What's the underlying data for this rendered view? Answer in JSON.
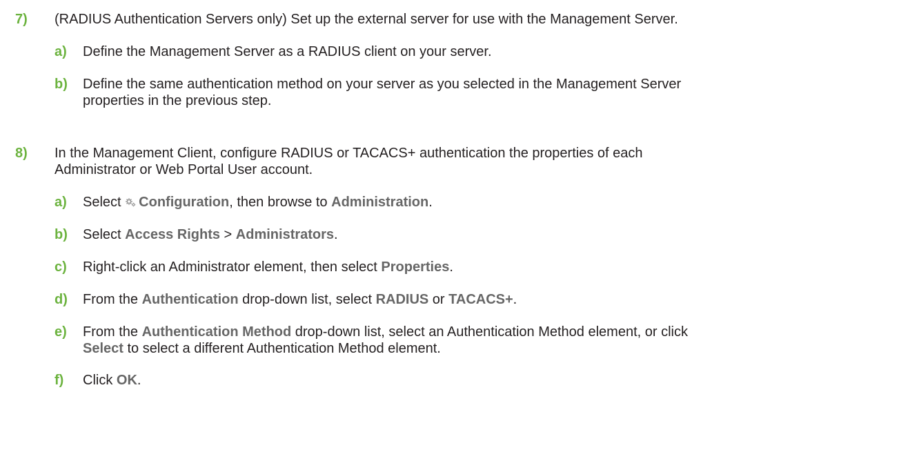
{
  "step7": {
    "number": "7)",
    "text": "(RADIUS Authentication Servers only) Set up the external server for use with the Management Server.",
    "substeps": [
      {
        "letter": "a)",
        "text": "Define the Management Server as a RADIUS client on your server."
      },
      {
        "letter": "b)",
        "line1": "Define the same authentication method on your server as you selected in the Management Server",
        "line2": "properties in the previous step."
      }
    ]
  },
  "step8": {
    "number": "8)",
    "line1": "In the Management Client, configure RADIUS or TACACS+ authentication the properties of each",
    "line2": "Administrator or Web Portal User account.",
    "substeps": {
      "a": {
        "letter": "a)",
        "pre": "Select ",
        "ui1": "Configuration",
        "mid": ", then browse to ",
        "ui2": "Administration",
        "post": ".",
        "icon": "configuration-gear-icon"
      },
      "b": {
        "letter": "b)",
        "pre": "Select ",
        "ui1": "Access Rights",
        "mid": " > ",
        "ui2": "Administrators",
        "post": "."
      },
      "c": {
        "letter": "c)",
        "pre": "Right-click an Administrator element, then select ",
        "ui1": "Properties",
        "post": "."
      },
      "d": {
        "letter": "d)",
        "pre": "From the ",
        "ui1": "Authentication",
        "mid": " drop-down list, select ",
        "ui2": "RADIUS",
        "mid2": " or ",
        "ui3": "TACACS+",
        "post": "."
      },
      "e": {
        "letter": "e)",
        "pre": "From the ",
        "ui1": "Authentication Method",
        "mid": " drop-down list, select an Authentication Method element, or click",
        "ui2": "Select",
        "post": " to select a different Authentication Method element."
      },
      "f": {
        "letter": "f)",
        "pre": "Click ",
        "ui1": "OK",
        "post": "."
      }
    }
  },
  "colors": {
    "accent": "#6cb33f",
    "ui_text": "#666666",
    "body_text": "#231f20"
  }
}
